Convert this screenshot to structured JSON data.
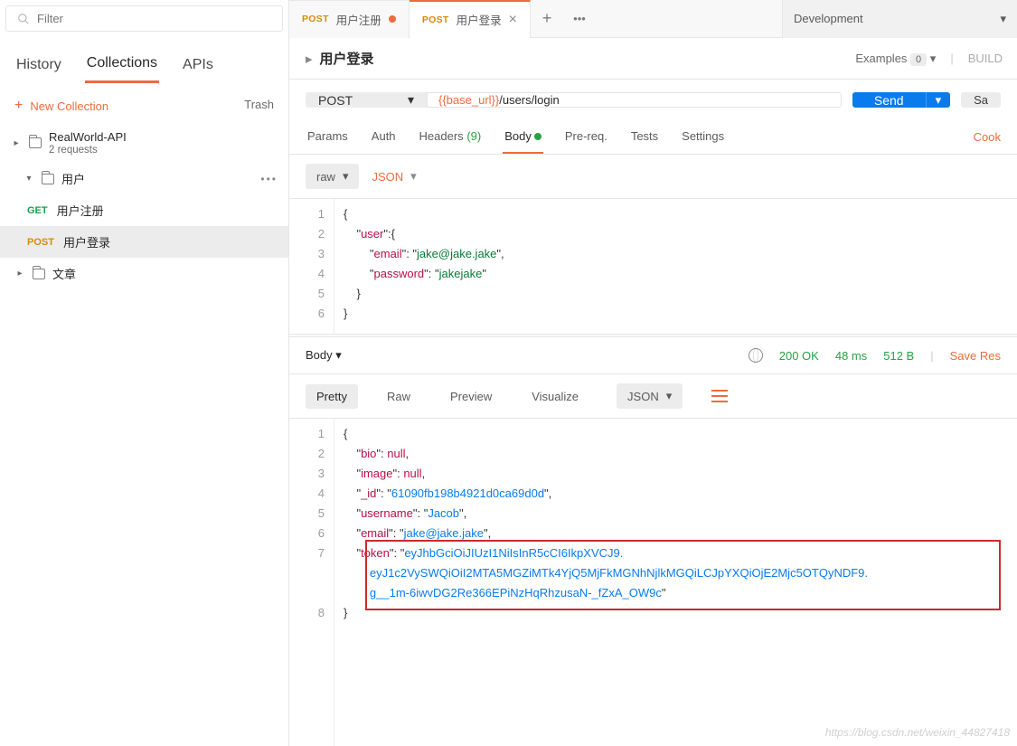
{
  "sidebar": {
    "filter_placeholder": "Filter",
    "tabs": {
      "history": "History",
      "collections": "Collections",
      "apis": "APIs"
    },
    "new_collection": "New Collection",
    "trash": "Trash",
    "collection_name": "RealWorld-API",
    "collection_sub": "2 requests",
    "folder_users": "用户",
    "folder_posts": "文章",
    "req_register": "用户注册",
    "req_login": "用户登录",
    "method_get": "GET",
    "method_post": "POST"
  },
  "tabs": {
    "t1_method": "POST",
    "t1_name": "用户注册",
    "t2_method": "POST",
    "t2_name": "用户登录",
    "env": "Development"
  },
  "titlebar": {
    "name": "用户登录",
    "examples": "Examples",
    "examples_count": "0",
    "build": "BUILD"
  },
  "request": {
    "method": "POST",
    "url_var": "{{base_url}}",
    "url_rest": "/users/login",
    "send": "Send",
    "save": "Sa"
  },
  "reqtabs": {
    "params": "Params",
    "auth": "Auth",
    "headers": "Headers",
    "headers_cnt": "(9)",
    "body": "Body",
    "prereq": "Pre-req.",
    "tests": "Tests",
    "settings": "Settings",
    "cookies": "Cook"
  },
  "bodymode": {
    "raw": "raw",
    "json": "JSON"
  },
  "body_lines": {
    "l1": "{",
    "l2a": "    \"",
    "l2b": "user",
    "l2c": "\":{",
    "l3a": "        \"",
    "l3b": "email",
    "l3c": "\": \"",
    "l3d": "jake@jake.jake",
    "l3e": "\",",
    "l4a": "        \"",
    "l4b": "password",
    "l4c": "\": \"",
    "l4d": "jakejake",
    "l4e": "\"",
    "l5": "    }",
    "l6": "}"
  },
  "response": {
    "body": "Body",
    "status": "200 OK",
    "time": "48 ms",
    "size": "512 B",
    "save": "Save Res",
    "pretty": "Pretty",
    "raw": "Raw",
    "preview": "Preview",
    "visualize": "Visualize",
    "json": "JSON"
  },
  "resp_body": {
    "bio_k": "bio",
    "bio_v": "null",
    "img_k": "image",
    "img_v": "null",
    "id_k": "_id",
    "id_v": "61090fb198b4921d0ca69d0d",
    "un_k": "username",
    "un_v": "Jacob",
    "em_k": "email",
    "em_v": "jake@jake.jake",
    "tk_k": "token",
    "tk_v1": "eyJhbGciOiJIUzI1NiIsInR5cCI6IkpXVCJ9.",
    "tk_v2": "eyJ1c2VySWQiOiI2MTA5MGZiMTk4YjQ5MjFkMGNhNjlkMGQiLCJpYXQiOjE2Mjc5OTQyNDF9.",
    "tk_v3": "g__1m-6iwvDG2Re366EPiNzHqRhzusaN-_fZxA_OW9c"
  },
  "watermark": "https://blog.csdn.net/weixin_44827418"
}
